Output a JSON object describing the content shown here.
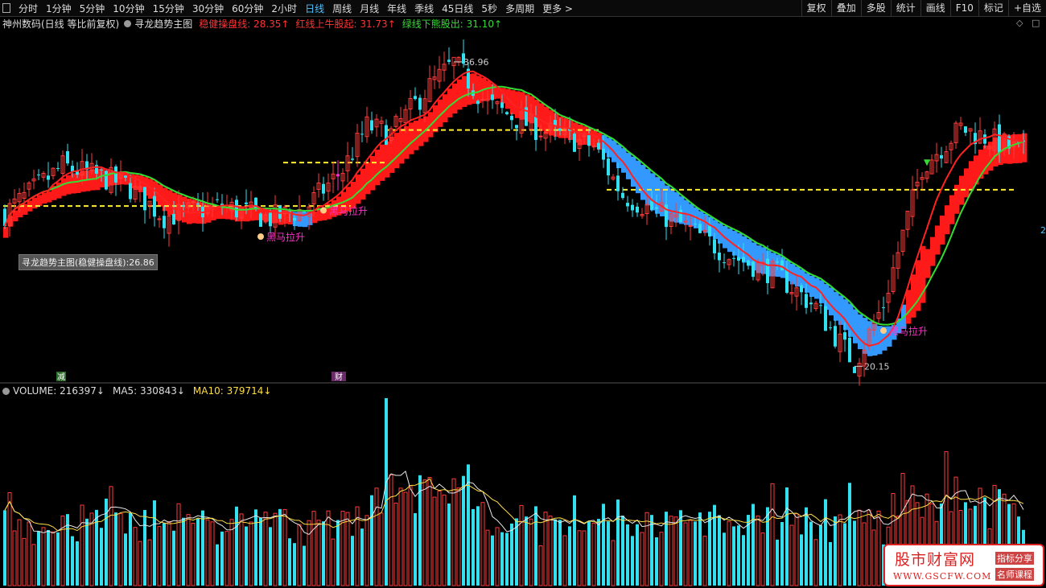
{
  "toolbar": {
    "periods": [
      "分时",
      "1分钟",
      "5分钟",
      "10分钟",
      "15分钟",
      "30分钟",
      "60分钟",
      "2小时",
      "日线",
      "周线",
      "月线",
      "年线",
      "季线",
      "45日线",
      "5秒",
      "多周期",
      "更多 >"
    ],
    "active": "日线",
    "tools": [
      "复权",
      "叠加",
      "多股",
      "统计",
      "画线",
      "F10",
      "标记",
      "+自选"
    ]
  },
  "legend": {
    "stock": "神州数码(日线 等比前复权)",
    "indicator": "寻龙趋势主图",
    "items": [
      {
        "text": "稳健操盘线: 28.35↑",
        "color": "#ff3333"
      },
      {
        "text": "红线上牛股起: 31.73↑",
        "color": "#ff3333"
      },
      {
        "text": "绿线下熊股出: 31.10↑",
        "color": "#33dd33"
      }
    ]
  },
  "tooltip": "寻龙趋势主图(稳健操盘线):26.86",
  "labels": {
    "heima": "黑马拉升",
    "high": "36.96",
    "low": "20.15",
    "jian": "减",
    "cai": "财",
    "right_axis": "2"
  },
  "volume_legend": [
    {
      "text": "VOLUME: 216397↓",
      "color": "#dddddd"
    },
    {
      "text": "MA5: 330843↓",
      "color": "#dddddd"
    },
    {
      "text": "MA10: 379714↓",
      "color": "#ffdd44"
    }
  ],
  "watermark": {
    "title": "股市财富网",
    "url": "WWW.GSCFW.COM",
    "badge1": "指标分享",
    "badge2": "名师课程"
  },
  "colors": {
    "up": "#ff3b3b",
    "down": "#33e0f0",
    "ma_red": "#ff2222",
    "ma_green": "#33dd33",
    "band_red": "#ff1a1a",
    "band_blue": "#3399ff",
    "dash": "#ffee33",
    "magenta": "#ff33cc"
  },
  "icons": [
    "pane-icon",
    "legend-toggle-icon",
    "diamond-icon",
    "window-icon",
    "down-arrow-icon",
    "hand-pointer-icon"
  ],
  "chart_data": {
    "type": "candlestick",
    "price_range": [
      19.5,
      38.6
    ],
    "high": 36.96,
    "low": 20.15,
    "dashed_levels": [
      {
        "from": 0,
        "to": 72,
        "value": 29.0
      },
      {
        "from": 58,
        "to": 79,
        "value": 31.4
      },
      {
        "from": 79,
        "to": 124,
        "value": 33.2
      },
      {
        "from": 125,
        "to": 210,
        "value": 29.9
      }
    ],
    "markers": [
      {
        "type": "heima",
        "index": 53,
        "label": "黑马拉升"
      },
      {
        "type": "heima",
        "index": 66,
        "label": "黑马拉升"
      },
      {
        "type": "heima",
        "index": 182,
        "label": "黑马拉升"
      },
      {
        "type": "down-arrow",
        "index": 191
      },
      {
        "type": "magenta-bar",
        "index": 69
      }
    ],
    "volume": {
      "last": 216397,
      "ma5": 330843,
      "ma10": 379714,
      "max": 980000
    }
  }
}
